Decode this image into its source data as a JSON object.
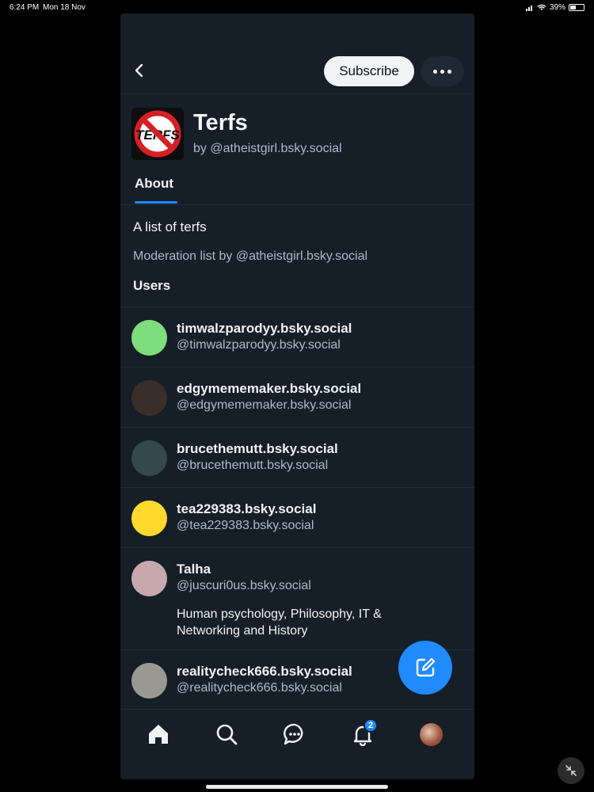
{
  "status_bar": {
    "time": "6:24 PM",
    "date": "Mon 18 Nov",
    "battery": "39%"
  },
  "header": {
    "subscribe_label": "Subscribe"
  },
  "list": {
    "title": "Terfs",
    "by_line": "by @atheistgirl.bsky.social",
    "avatar_text": "TERFS",
    "tab_label": "About",
    "description": "A list of terfs",
    "moderation_line": "Moderation list by @atheistgirl.bsky.social",
    "users_heading": "Users"
  },
  "users": [
    {
      "name": "timwalzparodyy.bsky.social",
      "handle": "@timwalzparodyy.bsky.social",
      "avatar_color": "#7ede7d",
      "bio": ""
    },
    {
      "name": "edgymememaker.bsky.social",
      "handle": "@edgymememaker.bsky.social",
      "avatar_color": "#3a2e2a",
      "bio": ""
    },
    {
      "name": "brucethemutt.bsky.social",
      "handle": "@brucethemutt.bsky.social",
      "avatar_color": "#34494d",
      "bio": ""
    },
    {
      "name": "tea229383.bsky.social",
      "handle": "@tea229383.bsky.social",
      "avatar_color": "#ffd92e",
      "bio": ""
    },
    {
      "name": "Talha",
      "handle": "@juscuri0us.bsky.social",
      "avatar_color": "#c7a9ad",
      "bio": "Human psychology, Philosophy, IT & Networking and History"
    },
    {
      "name": "realitycheck666.bsky.social",
      "handle": "@realitycheck666.bsky.social",
      "avatar_color": "#9a9892",
      "bio": ""
    }
  ],
  "bottom_nav": {
    "items": [
      "home-icon",
      "search-icon",
      "chat-icon",
      "bell-icon",
      "profile-avatar"
    ],
    "notification_count": "2"
  },
  "colors": {
    "accent": "#208bfe",
    "background": "#161e27",
    "border": "#222c37",
    "muted_text": "#aebbc9"
  }
}
